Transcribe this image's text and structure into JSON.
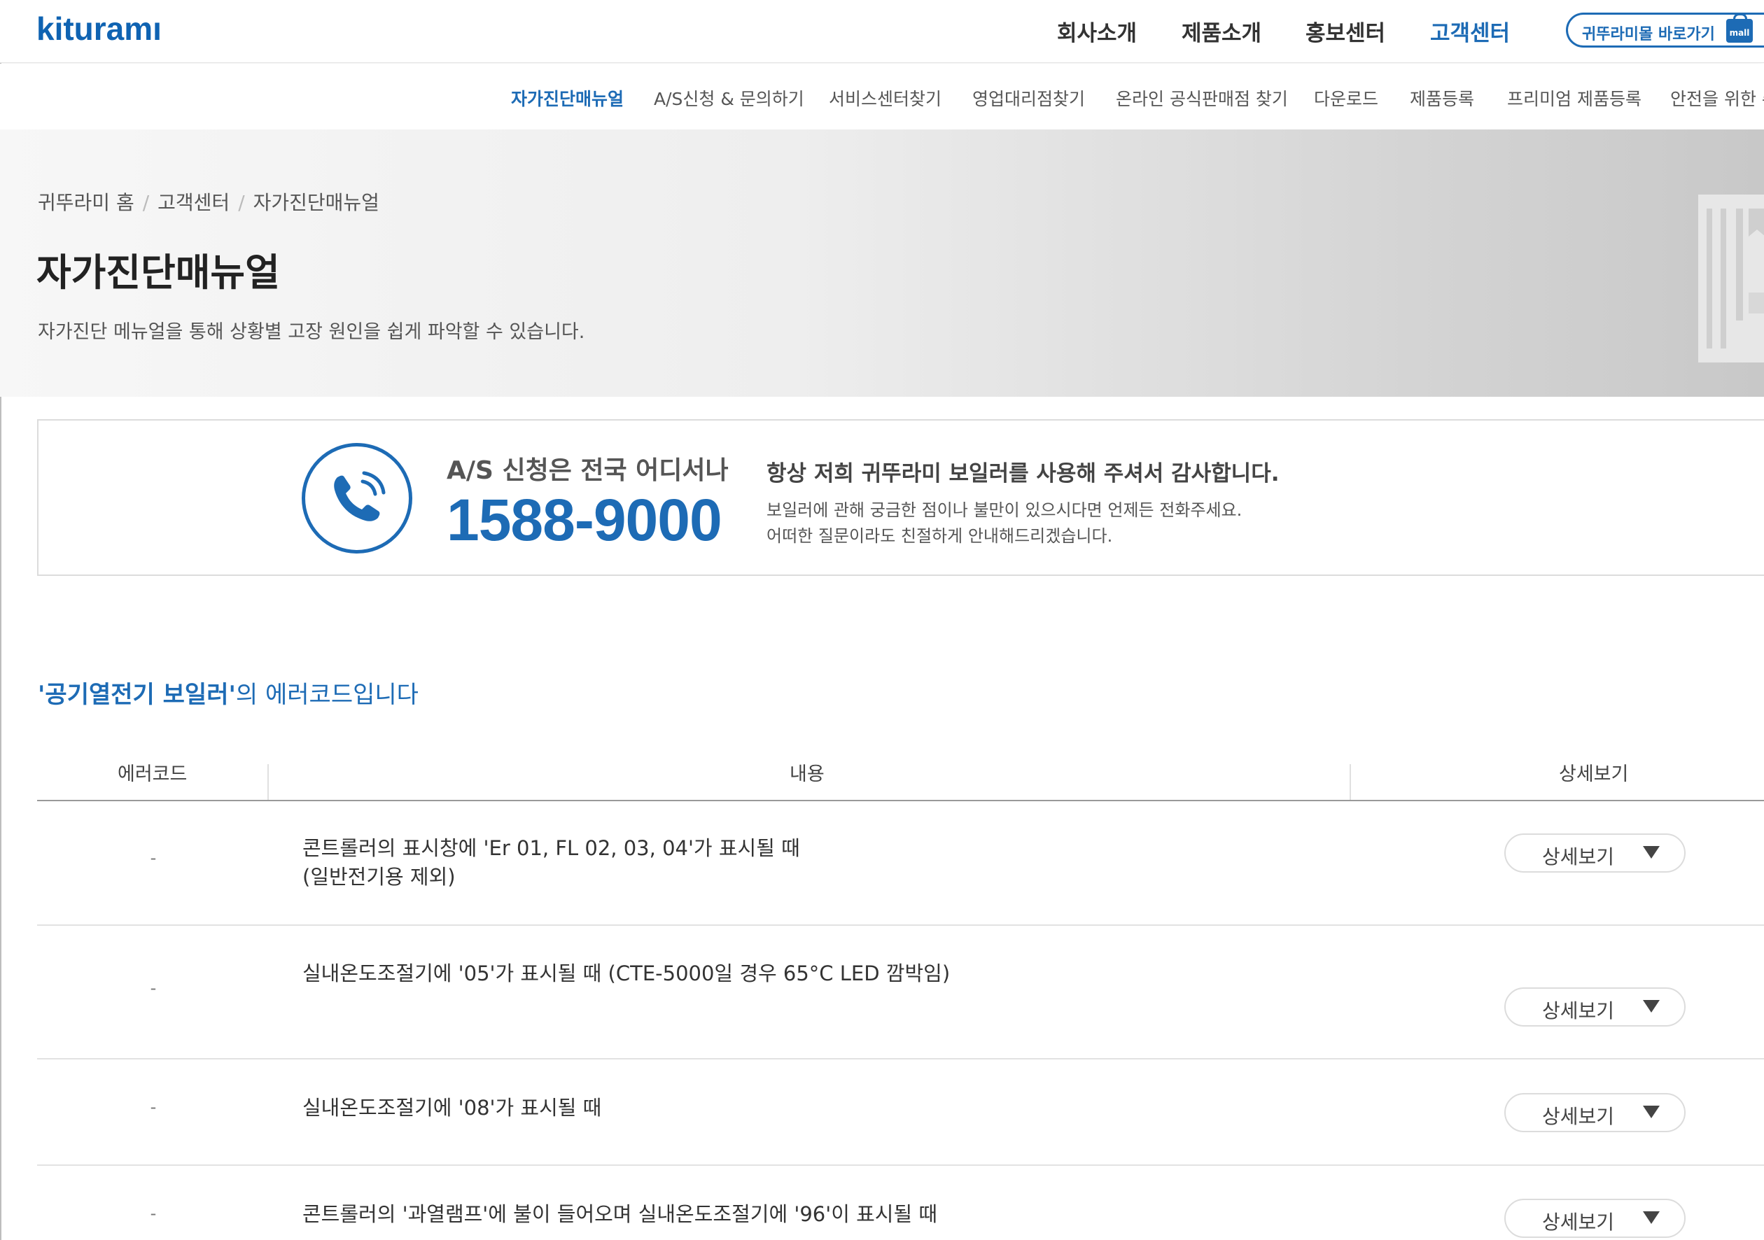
{
  "header": {
    "logo_text": "kituramı",
    "nav": [
      "회사소개",
      "제품소개",
      "홍보센터",
      "고객센터"
    ],
    "active_nav": "고객센터",
    "mall_label": "귀뚜라미몰 바로가기",
    "mall_icon": "mall"
  },
  "subnav": {
    "items": [
      "자가진단매뉴얼",
      "A/S신청 & 문의하기",
      "서비스센터찾기",
      "영업대리점찾기",
      "온라인 공식판매점 찾기",
      "다운로드",
      "제품등록",
      "프리미엄 제품등록",
      "안전을 위한 주"
    ],
    "active": "자가진단매뉴얼"
  },
  "hero": {
    "breadcrumb": [
      "귀뚜라미 홈",
      "고객센터",
      "자가진단매뉴얼"
    ],
    "title": "자가진단매뉴얼",
    "description": "자가진단 메뉴얼을 통해 상황별 고장 원인을 쉽게 파악할 수 있습니다."
  },
  "callbox": {
    "subtitle": "A/S 신청은 전국 어디서나",
    "number": "1588-9000",
    "heading": "항상 저희 귀뚜라미 보일러를 사용해 주셔서 감사합니다.",
    "line1": "보일러에 관해 궁금한 점이나 불만이 있으시다면 언제든 전화주세요.",
    "line2": "어떠한 질문이라도 친절하게 안내해드리겠습니다."
  },
  "section": {
    "title_highlight": "'공기열전기 보일러'",
    "title_rest": "의 에러코드입니다"
  },
  "table": {
    "headers": [
      "에러코드",
      "내용",
      "상세보기"
    ],
    "rows": [
      {
        "code": "-",
        "line1": "콘트롤러의 표시창에 'Er 01, FL 02, 03, 04'가 표시될 때",
        "line2": "(일반전기용 제외)",
        "button": "상세보기"
      },
      {
        "code": "-",
        "line1": "실내온도조절기에 '05'가 표시될 때 (CTE-5000일 경우 65°C LED 깜박임)",
        "line2": "",
        "button": "상세보기"
      },
      {
        "code": "-",
        "line1": "실내온도조절기에 '08'가 표시될 때",
        "line2": "",
        "button": "상세보기"
      },
      {
        "code": "-",
        "line1": "콘트롤러의 '과열램프'에 불이 들어오며 실내온도조절기에 '96'이 표시될 때",
        "line2": "",
        "button": "상세보기"
      }
    ]
  },
  "colors": {
    "brand_blue": "#1d6bb5",
    "logo_dot": "#e83a2e"
  }
}
